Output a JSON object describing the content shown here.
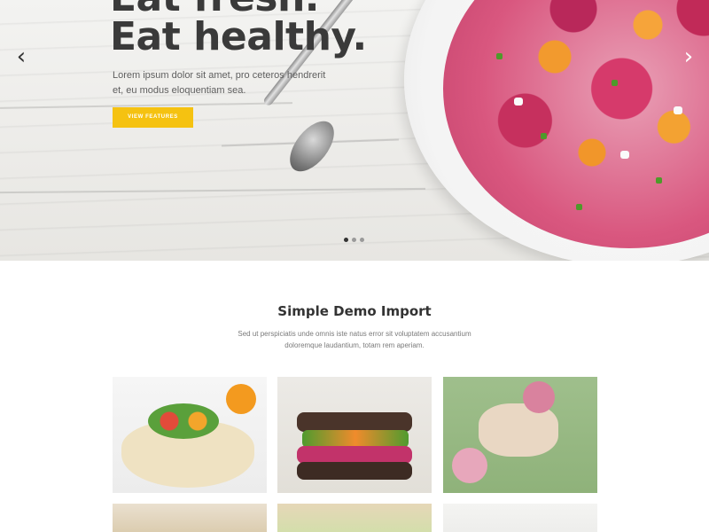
{
  "hero": {
    "title_line1": "Eat fresh.",
    "title_line2": "Eat healthy.",
    "subtitle": "Lorem ipsum dolor sit amet, pro ceteros hendrerit et, eu modus eloquentiam sea.",
    "button_label": "VIEW FEATURES",
    "prev_arrow": "‹",
    "next_arrow": "›",
    "slide_count": 3,
    "active_slide": 1,
    "accent_color": "#f5c211"
  },
  "section": {
    "title": "Simple Demo Import",
    "description": "Sed ut perspiciatis unde omnis iste natus error sit voluptatem accusantium doloremque laudantium, totam rem aperiam."
  },
  "gallery": {
    "items": [
      {
        "image": "tortilla-wrap-photo"
      },
      {
        "image": "vegetable-sandwich-photo"
      },
      {
        "image": "chicken-salad-photo"
      },
      {
        "image": "food-photo"
      },
      {
        "image": "food-photo"
      },
      {
        "image": "food-photo"
      }
    ]
  }
}
